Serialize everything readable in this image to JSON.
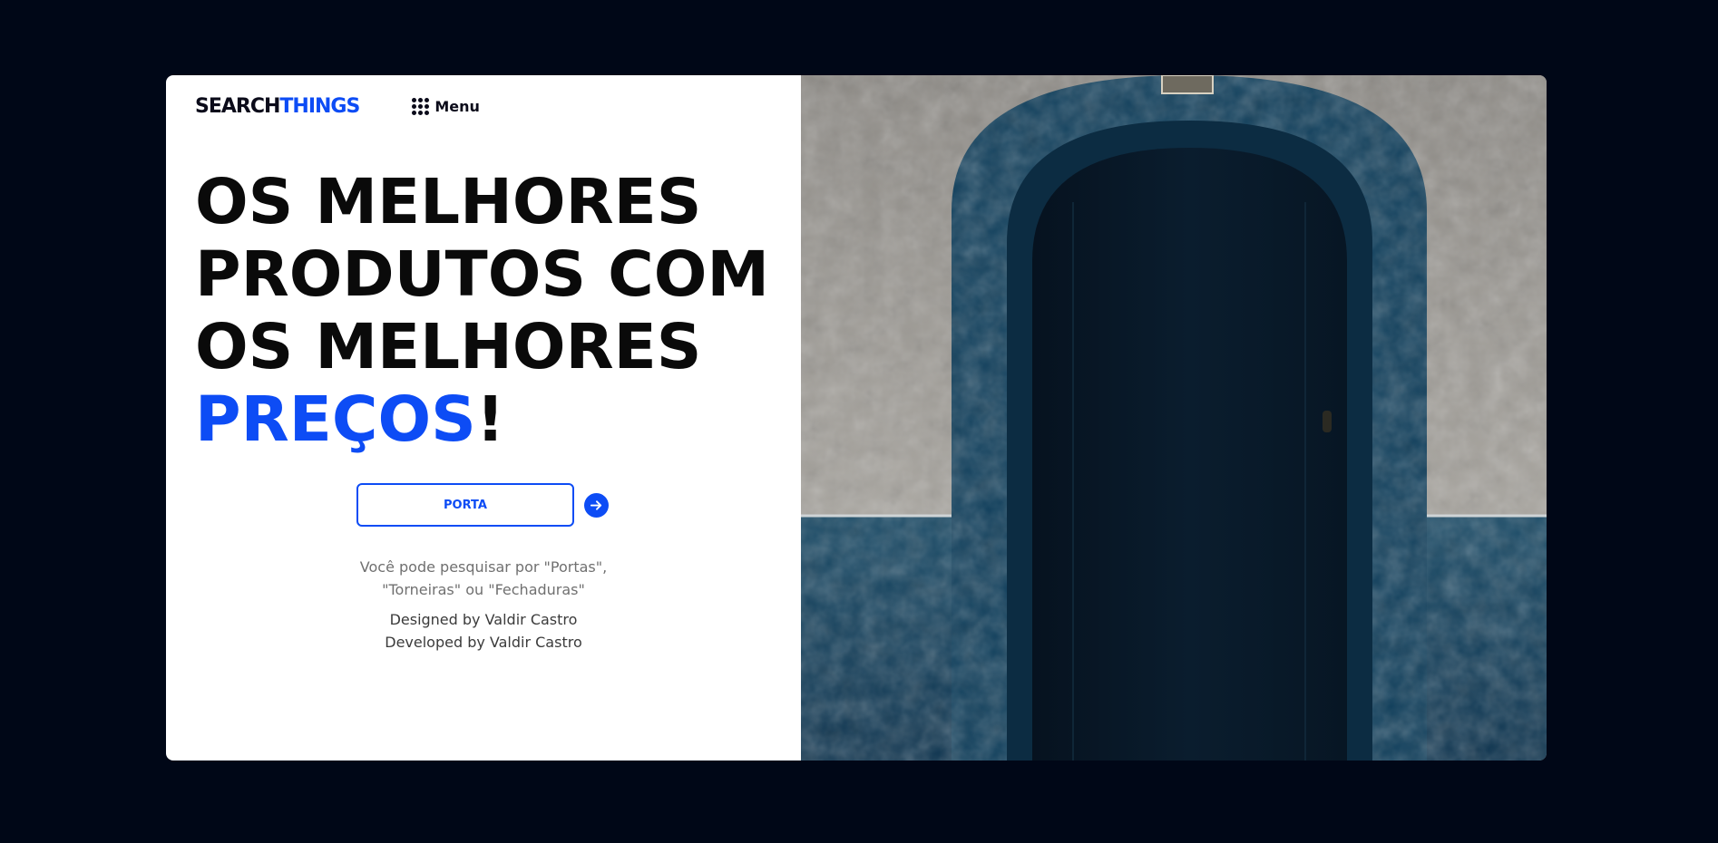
{
  "header": {
    "logo_part1": "SEARCH",
    "logo_part2": "THINGS",
    "menu_label": "Menu"
  },
  "hero": {
    "line1": "OS MELHORES",
    "line2": "PRODUTOS COM",
    "line3": "OS MELHORES",
    "highlight": "PREÇOS",
    "punctuation": "!"
  },
  "search": {
    "value": "PORTA",
    "hint_line1": "Você pode pesquisar por \"Portas\",",
    "hint_line2": "\"Torneiras\" ou \"Fechaduras\""
  },
  "credits": {
    "designed": "Designed by Valdir Castro",
    "developed": "Developed by Valdir Castro"
  },
  "colors": {
    "accent": "#0d4cf5",
    "background": "#000717"
  },
  "icons": {
    "menu": "grid-dots-icon",
    "search_submit": "arrow-right-icon"
  }
}
